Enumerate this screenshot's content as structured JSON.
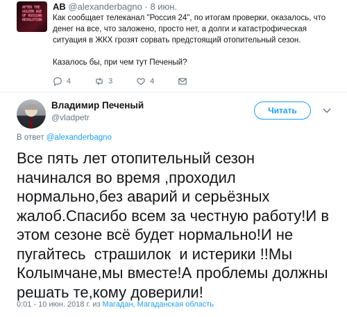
{
  "parent_tweet": {
    "name": "АВ",
    "handle": "@alexanderbagno",
    "separator": "·",
    "date": "8 июн.",
    "avatar_text": "AFTER THE\nGOLDEN AGE\nOF RUSSIAN\nREVOLUTION",
    "paragraphs": [
      "Как сообщает телеканал \"Россия 24\", по итогам проверки, оказалось, что денег на все, что заложено, просто нет, а долги и катастрофическая ситуация в ЖКХ грозят сорвать предстоящий отопительный сезон.",
      "Казалось бы, при чем тут Печеный?"
    ],
    "actions": {
      "reply_count": "4",
      "retweet_count": "3",
      "like_count": "4"
    }
  },
  "main_tweet": {
    "name": "Владимир Печеный",
    "handle": "@vladpetr",
    "follow_label": "Читать",
    "reply_prefix": "В ответ",
    "reply_to": "@alexanderbagno",
    "text_lines": [
      "Все пять лет отопительный сезон",
      "начинался во время ,проходил",
      "нормально,без аварий и серьёзных",
      "жалоб.Спасибо всем за честную работу!И в",
      "этом сезоне всё будет нормально!И не",
      "пугайтесь  страшилок  и истерики !!Мы",
      "Колымчане,мы вместе!А проблемы должны",
      "решать те,кому доверили!"
    ],
    "timestamp": "0:01 - 10 июн. 2018 г.",
    "location_prefix": "из",
    "location": "Магадан, Магаданская область"
  },
  "colors": {
    "accent": "#1da1f2",
    "muted": "#657786",
    "text": "#14171a",
    "divider": "#e6ecf0"
  },
  "icons": [
    "reply-icon",
    "retweet-icon",
    "like-icon",
    "message-icon",
    "chevron-down-icon"
  ]
}
